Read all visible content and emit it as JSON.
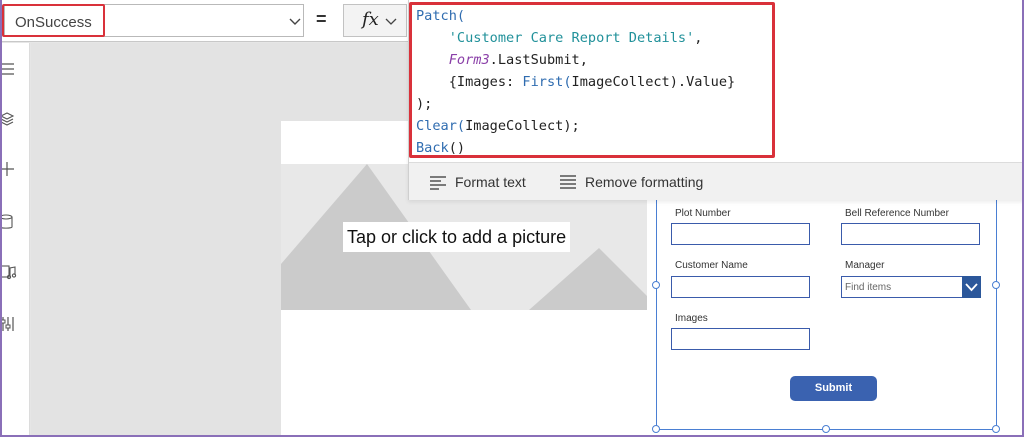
{
  "formula_bar": {
    "property": "OnSuccess",
    "fx_label": "fx",
    "equals": "="
  },
  "formula_code": {
    "line1_func": "Patch(",
    "line2_str": "'Customer Care Report Details'",
    "line2_punct": ",",
    "line3_ctrl": "Form3",
    "line3_rest": ".LastSubmit,",
    "line4_open": "{Images: ",
    "line4_func": "First(",
    "line4_rest": "ImageCollect).Value}",
    "line5": ");",
    "line6_func": "Clear(",
    "line6_rest": "ImageCollect);",
    "line7_func": "Back",
    "line7_rest": "()"
  },
  "editor_footer": {
    "format_text": "Format text",
    "remove_formatting": "Remove formatting"
  },
  "image_control": {
    "hint": "Tap or click to add a picture"
  },
  "form": {
    "fields": [
      {
        "label": "Plot Number",
        "value": ""
      },
      {
        "label": "Bell Reference Number",
        "value": ""
      },
      {
        "label": "Customer Name",
        "value": ""
      },
      {
        "label": "Manager",
        "placeholder": "Find items"
      },
      {
        "label": "Images",
        "value": ""
      }
    ],
    "submit_label": "Submit"
  },
  "left_rail": {
    "icons": [
      "hamburger-icon",
      "layers-icon",
      "plus-icon",
      "database-icon",
      "media-icon",
      "tools-icon"
    ]
  },
  "colors": {
    "highlight_red": "#d9313a",
    "selection_blue": "#4a7fd3",
    "button_blue": "#3a62b0",
    "keyword_blue": "#2f6cb0",
    "string_teal": "#21919a",
    "control_purple": "#8a3fa8",
    "frame_purple": "#8a6fb8"
  }
}
